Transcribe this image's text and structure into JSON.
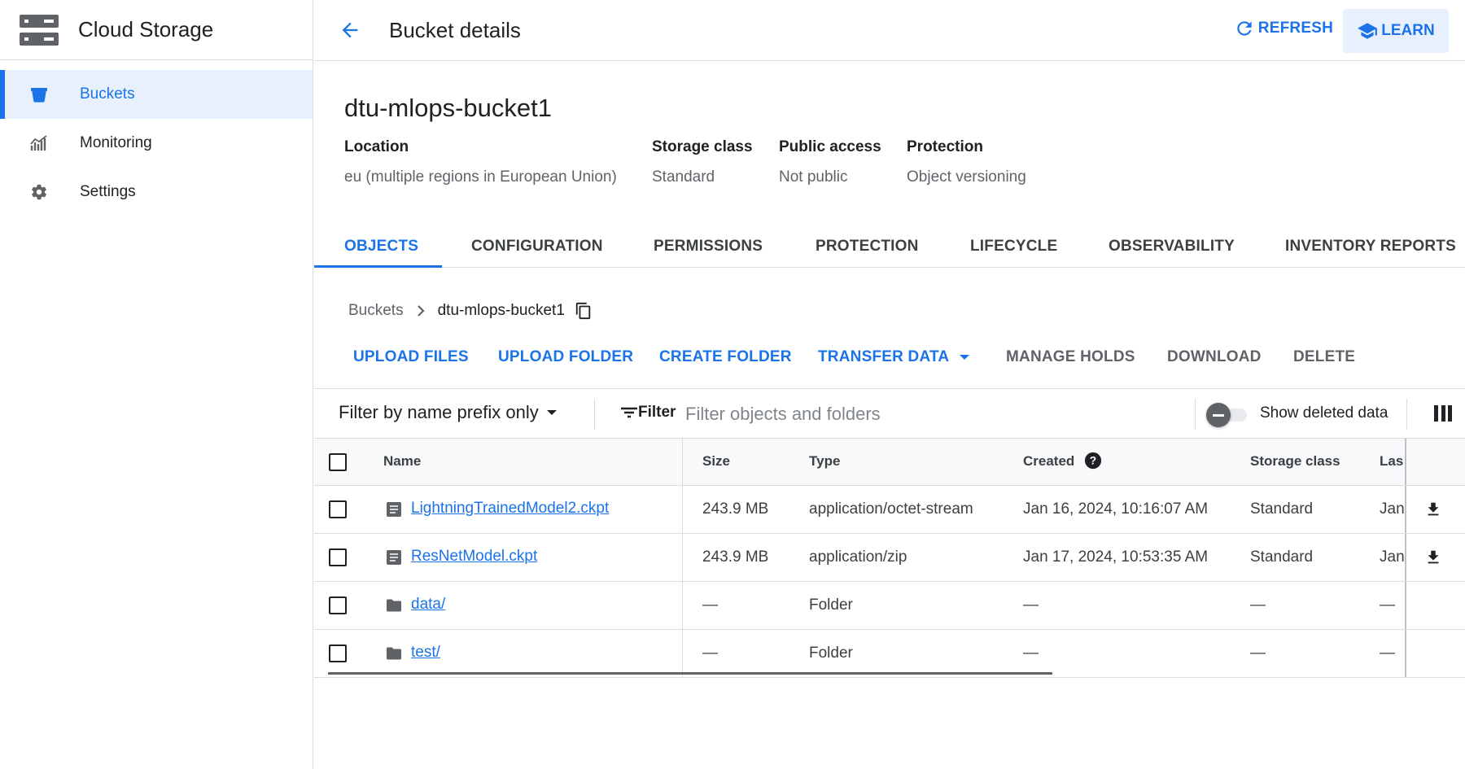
{
  "app": {
    "product_name": "Cloud Storage",
    "nav": [
      {
        "label": "Buckets",
        "icon": "bucket-icon",
        "active": true
      },
      {
        "label": "Monitoring",
        "icon": "monitoring-icon",
        "active": false
      },
      {
        "label": "Settings",
        "icon": "gear-icon",
        "active": false
      }
    ]
  },
  "topbar": {
    "title": "Bucket details",
    "refresh_label": "REFRESH",
    "learn_label": "LEARN"
  },
  "bucket": {
    "name": "dtu-mlops-bucket1",
    "meta": [
      {
        "label": "Location",
        "value": "eu (multiple regions in European Union)"
      },
      {
        "label": "Storage class",
        "value": "Standard"
      },
      {
        "label": "Public access",
        "value": "Not public"
      },
      {
        "label": "Protection",
        "value": "Object versioning"
      }
    ]
  },
  "tabs": [
    "OBJECTS",
    "CONFIGURATION",
    "PERMISSIONS",
    "PROTECTION",
    "LIFECYCLE",
    "OBSERVABILITY",
    "INVENTORY REPORTS"
  ],
  "active_tab": "OBJECTS",
  "breadcrumb": {
    "root": "Buckets",
    "current": "dtu-mlops-bucket1"
  },
  "actions": {
    "upload_files": "UPLOAD FILES",
    "upload_folder": "UPLOAD FOLDER",
    "create_folder": "CREATE FOLDER",
    "transfer_data": "TRANSFER DATA",
    "manage_holds": "MANAGE HOLDS",
    "download": "DOWNLOAD",
    "delete": "DELETE"
  },
  "filter": {
    "prefix_select": "Filter by name prefix only",
    "filter_label": "Filter",
    "placeholder": "Filter objects and folders",
    "show_deleted_label": "Show deleted data",
    "show_deleted_on": false
  },
  "table": {
    "headers": {
      "name": "Name",
      "size": "Size",
      "type": "Type",
      "created": "Created",
      "storage_class": "Storage class",
      "last_modified": "Las"
    },
    "rows": [
      {
        "name": "LightningTrainedModel2.ckpt",
        "kind": "file",
        "size": "243.9 MB",
        "type": "application/octet-stream",
        "created": "Jan 16, 2024, 10:16:07 AM",
        "storage_class": "Standard",
        "last_modified": "Jan",
        "downloadable": true
      },
      {
        "name": "ResNetModel.ckpt",
        "kind": "file",
        "size": "243.9 MB",
        "type": "application/zip",
        "created": "Jan 17, 2024, 10:53:35 AM",
        "storage_class": "Standard",
        "last_modified": "Jan",
        "downloadable": true
      },
      {
        "name": "data/",
        "kind": "folder",
        "size": "—",
        "type": "Folder",
        "created": "—",
        "storage_class": "—",
        "last_modified": "—",
        "downloadable": false
      },
      {
        "name": "test/",
        "kind": "folder",
        "size": "—",
        "type": "Folder",
        "created": "—",
        "storage_class": "—",
        "last_modified": "—",
        "downloadable": false
      }
    ]
  },
  "colors": {
    "accent": "#1a73e8",
    "text": "#202124",
    "muted": "#5f6368",
    "divider": "#dadce0",
    "active_nav_bg": "#e8f0fe"
  }
}
